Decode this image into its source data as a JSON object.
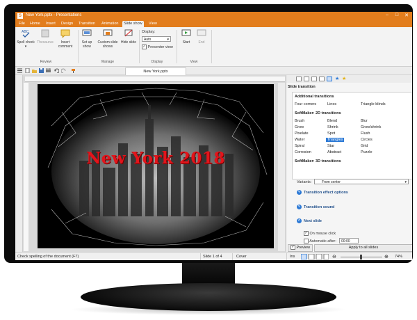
{
  "window": {
    "title": "New York.pptx - Presentations",
    "app_icon": "S",
    "controls": [
      "–",
      "□",
      "✕"
    ]
  },
  "menu": [
    "File",
    "Home",
    "Insert",
    "Design",
    "Transition",
    "Animation",
    "Slide show",
    "View"
  ],
  "menu_active_index": 6,
  "ribbon": {
    "review": {
      "spell_check": "Spell check ▾",
      "thesaurus": "Thesaurus",
      "insert_comment": "Insert comment",
      "label": "Review"
    },
    "manage": {
      "setup_show": "Set up show",
      "custom_slide_shows": "Custom slide shows",
      "hide_slide": "Hide slide",
      "label": "Manage"
    },
    "display": {
      "caption": "Display:",
      "value": "Auto",
      "presenter_view": "Presenter view",
      "label": "Display"
    },
    "view": {
      "start": "Start",
      "end": "End",
      "label": "View"
    }
  },
  "document_tab": "New York.pptx",
  "slide": {
    "title": "New York 2018"
  },
  "sidebar": {
    "panel_title": "Slide transition",
    "categories": [
      {
        "name": "Additional transitions",
        "items": [
          "Four corners",
          "Lines",
          "Triangle blinds"
        ]
      },
      {
        "name": "SoftMaker: 2D transitions",
        "items": [
          "Brush",
          "Blend",
          "Blur",
          "Grow",
          "Shrink",
          "Grow/shrink",
          "Pixelate",
          "Spot",
          "Flush",
          "Water",
          "Triangles",
          "Circles",
          "Spiral",
          "Star",
          "Grid",
          "Corrosion",
          "Abstract",
          "Puzzle"
        ]
      },
      {
        "name": "SoftMaker: 3D transitions",
        "items": []
      }
    ],
    "selected_item": "Triangles",
    "variants_label": "Variants:",
    "variants_value": "From center",
    "transition_effect_options": "Transition effect options",
    "transition_sound": "Transition sound",
    "next_slide": "Next slide",
    "on_mouse_click": "On mouse click",
    "automatic_after": "Automatic after:",
    "automatic_value": "00:00",
    "preview": "Preview",
    "apply_all": "Apply to all slides"
  },
  "status": {
    "hint": "Check spelling of the document (F7)",
    "slide": "Slide 1 of 4",
    "layout": "Cover",
    "mode": "Ins",
    "zoom": "74%"
  },
  "colors": {
    "accent": "#e27d1d",
    "selection": "#2d7ad6",
    "slide_title": "#e3141b"
  }
}
